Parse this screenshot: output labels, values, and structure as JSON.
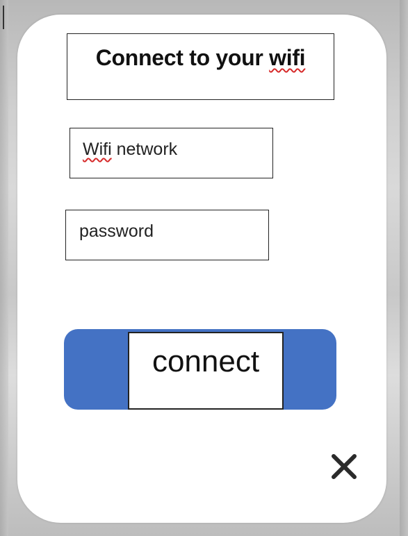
{
  "dialog": {
    "title_prefix": "Connect to your ",
    "title_squiggle_word": "wifi",
    "network_field": {
      "squiggle_word": "Wifi",
      "rest": " network"
    },
    "password_field": {
      "value": "password"
    },
    "connect_button": {
      "label": "connect"
    },
    "close_icon": "close-icon"
  },
  "colors": {
    "button_blue": "#4472c4",
    "spellcheck_red": "#d62a2a",
    "dialog_bg": "#ffffff"
  }
}
